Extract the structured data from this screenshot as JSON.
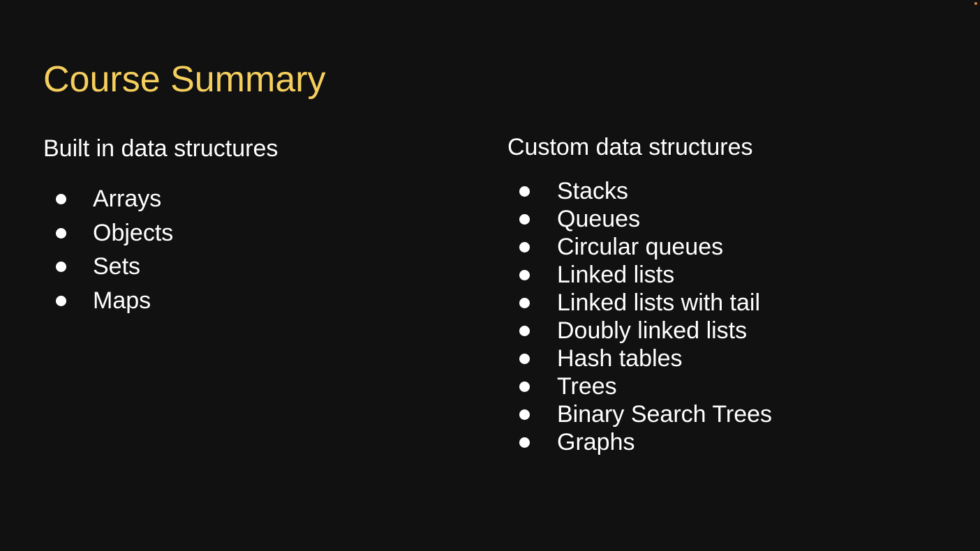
{
  "slide": {
    "title": "Course Summary",
    "title_color": "#f5cf5d",
    "background": "#111111",
    "left_column": {
      "heading": "Built in data structures",
      "items": [
        "Arrays",
        "Objects",
        "Sets",
        "Maps"
      ]
    },
    "right_column": {
      "heading": "Custom data structures",
      "items": [
        "Stacks",
        "Queues",
        "Circular queues",
        "Linked lists",
        "Linked lists with tail",
        "Doubly linked lists",
        "Hash tables",
        "Trees",
        "Binary Search Trees",
        "Graphs"
      ]
    }
  }
}
